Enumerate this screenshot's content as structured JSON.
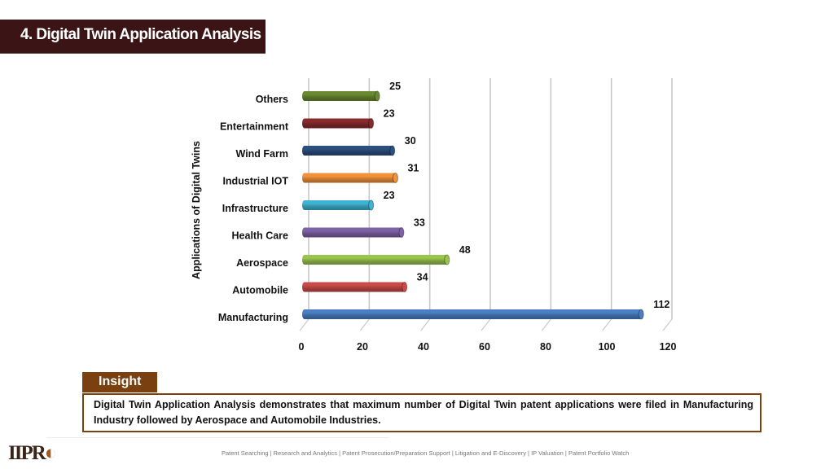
{
  "header": {
    "title": "4. Digital Twin Application Analysis"
  },
  "chart_data": {
    "type": "bar",
    "orientation": "horizontal",
    "style": "3d-cylinder",
    "title": "",
    "xlabel": "",
    "ylabel": "Applications of Digital Twins",
    "categories": [
      "Manufacturing",
      "Automobile",
      "Aerospace",
      "Health Care",
      "Infrastructure",
      "Industrial IOT",
      "Wind Farm",
      "Entertainment",
      "Others"
    ],
    "values": [
      112,
      34,
      48,
      33,
      23,
      31,
      30,
      23,
      25
    ],
    "colors": [
      "#4a7fc4",
      "#c94b48",
      "#9ac44f",
      "#7e62a6",
      "#3fb4d2",
      "#f2923a",
      "#2c4f80",
      "#882a2c",
      "#6a8a30"
    ],
    "xlim": [
      0,
      120
    ],
    "xticks": [
      0,
      20,
      40,
      60,
      80,
      100,
      120
    ],
    "xtick_labels": [
      "0",
      "20",
      "40",
      "60",
      "80",
      "100",
      "120"
    ],
    "grid": "vertical",
    "legend": "none"
  },
  "insight": {
    "label": "Insight",
    "text": "Digital Twin Application Analysis demonstrates that maximum number of Digital Twin patent applications were filed in Manufacturing Industry followed by Aerospace and Automobile Industries."
  },
  "footer": {
    "logo_main": "IIPR",
    "logo_mark": "◐",
    "services": "Patent Searching | Research and Analytics | Patent Prosecution/Preparation Support | Litigation and E-Discovery | IP Valuation | Patent Portfolio Watch"
  }
}
